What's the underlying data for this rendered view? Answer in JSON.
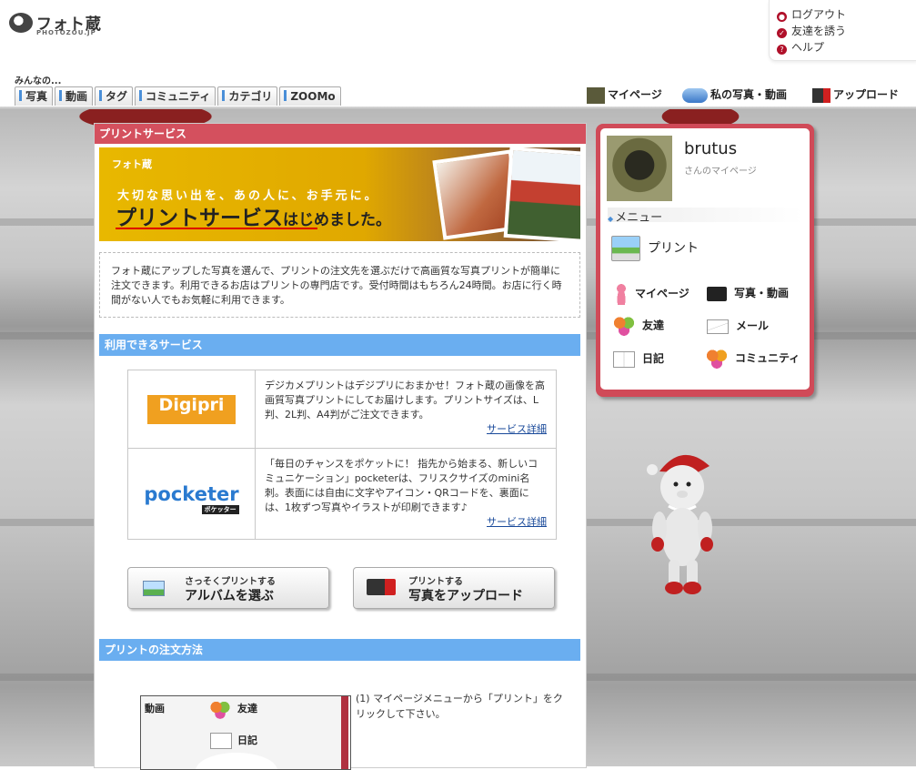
{
  "header": {
    "logo_text": "フォト蔵",
    "logo_sub": "PHOTOZOU.JP",
    "user_menu": [
      {
        "label": "ログアウト",
        "icon": "logout-icon"
      },
      {
        "label": "友達を誘う",
        "icon": "invite-icon"
      },
      {
        "label": "ヘルプ",
        "icon": "help-icon"
      }
    ],
    "everyone_label": "みんなの...",
    "tabs": [
      "写真",
      "動画",
      "タグ",
      "コミュニティ",
      "カテゴリ",
      "ZOOMo"
    ],
    "right_nav": {
      "mypage": "マイページ",
      "my_photos": "私の写真・動画",
      "upload": "アップロード"
    }
  },
  "main": {
    "section_title": "プリントサービス",
    "banner": {
      "brand": "フォト蔵",
      "catch": "大切な思い出を、あの人に、お手元に。",
      "headline_main": "プリントサービス",
      "headline_tail": "はじめました。"
    },
    "intro": "フォト蔵にアップした写真を選んで、プリントの注文先を選ぶだけで高画質な写真プリントが簡単に注文できます。利用できるお店はプリントの専門店です。受付時間はもちろん24時間。お店に行く時間がない人でもお気軽に利用できます。",
    "services_heading": "利用できるサービス",
    "services": [
      {
        "logo": "Digipri",
        "description": "デジカメプリントはデジプリにおまかせ！フォト蔵の画像を高画質写真プリントにしてお届けします。プリントサイズは、L判、2L判、A4判がご注文できます。",
        "more": "サービス詳細"
      },
      {
        "logo": "pocketer",
        "logo_sub": "ポケッター",
        "description": "「毎日のチャンスをポケットに！ 指先から始まる、新しいコミュニケーション」pocketerは、フリスクサイズのmini名刺。表面には自由に文字やアイコン・QRコードを、裏面には、1枚ずつ写真やイラストが印刷できます♪",
        "more": "サービス詳細"
      }
    ],
    "buttons": {
      "album_small": "さっそくプリントする",
      "album_large": "アルバムを選ぶ",
      "upload_small": "プリントする",
      "upload_large": "写真をアップロード"
    },
    "order_heading": "プリントの注文方法",
    "step1": {
      "text": "(1) マイページメニューから「プリント」をクリックして下さい。",
      "screenshot_labels": [
        "動画",
        "友達",
        "日記"
      ]
    }
  },
  "profile": {
    "username": "brutus",
    "subtitle": "さんのマイページ",
    "menu_heading": "メニュー",
    "print_label": "プリント",
    "items": [
      {
        "label": "マイページ",
        "icon": "mypage-icon"
      },
      {
        "label": "写真・動画",
        "icon": "camera-icon"
      },
      {
        "label": "友達",
        "icon": "friends-icon"
      },
      {
        "label": "メール",
        "icon": "mail-icon"
      },
      {
        "label": "日記",
        "icon": "diary-icon"
      },
      {
        "label": "コミュニティ",
        "icon": "community-icon"
      }
    ]
  },
  "colors": {
    "red_header": "#d4505e",
    "blue_header": "#6aaef0",
    "tab_accent": "#4a8fd8",
    "link": "#1a4a9a"
  }
}
